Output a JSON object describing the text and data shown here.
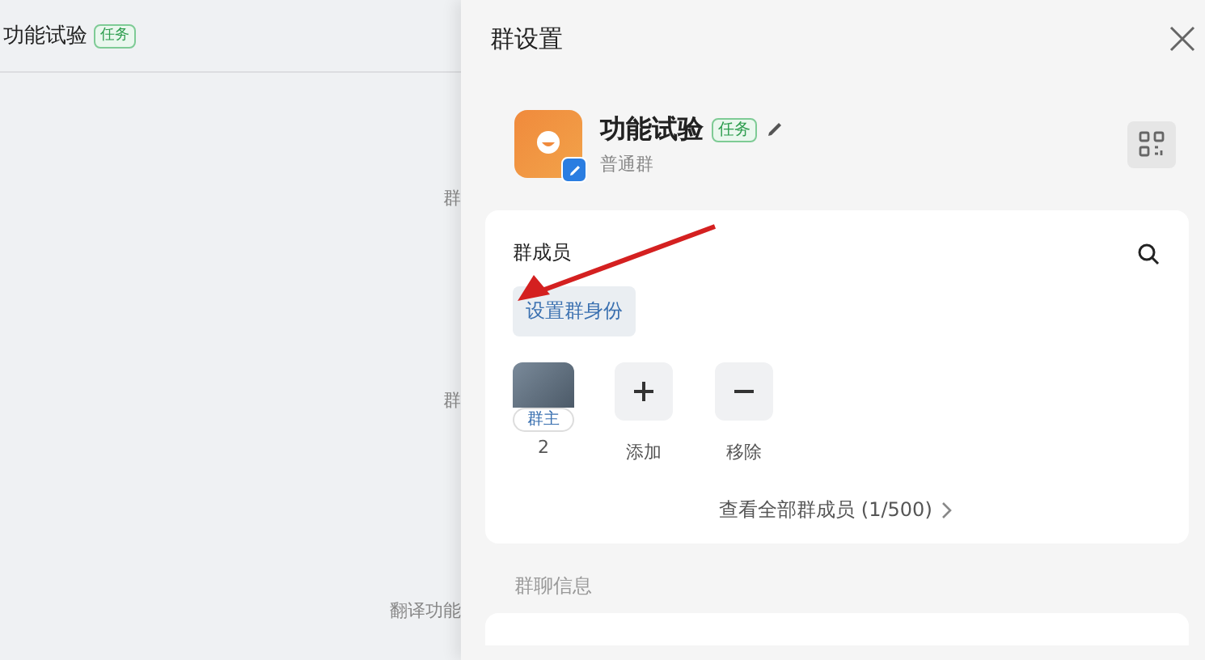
{
  "chat": {
    "title": "功能试验",
    "tag": "任务",
    "peeks": [
      "群",
      "群",
      "翻译功能"
    ]
  },
  "settings": {
    "title": "群设置",
    "group": {
      "name": "功能试验",
      "tag": "任务",
      "type": "普通群"
    },
    "members": {
      "title": "群成员",
      "set_role_button": "设置群身份",
      "items": [
        {
          "kind": "member",
          "badge": "群主",
          "label": "2"
        },
        {
          "kind": "add",
          "label": "添加"
        },
        {
          "kind": "remove",
          "label": "移除"
        }
      ],
      "view_all": "查看全部群成员 (1/500)"
    },
    "info_section": "群聊信息"
  }
}
